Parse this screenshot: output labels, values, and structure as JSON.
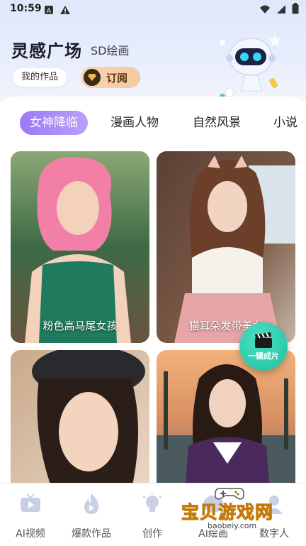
{
  "status_bar": {
    "time": "10:59",
    "icons_left": [
      "notification-a-icon",
      "warning-icon"
    ],
    "icons_right": [
      "wifi-icon",
      "signal-icon",
      "battery-icon"
    ]
  },
  "header": {
    "title": "灵感广场",
    "subtitle": "SD绘画",
    "my_works": "我的作品",
    "subscribe": "订阅"
  },
  "tabs": [
    {
      "label": "女神降临",
      "active": true
    },
    {
      "label": "漫画人物",
      "active": false
    },
    {
      "label": "自然风景",
      "active": false
    },
    {
      "label": "小说",
      "active": false
    }
  ],
  "cards": [
    {
      "caption": "粉色高马尾女孩"
    },
    {
      "caption": "猫耳朵发带美女"
    },
    {
      "caption": ""
    },
    {
      "caption": ""
    }
  ],
  "fab": {
    "label": "一键成片",
    "icon": "clapperboard-icon"
  },
  "bottom_nav": [
    {
      "label": "AI视频",
      "icon": "tv-icon"
    },
    {
      "label": "爆款作品",
      "icon": "flame-play-icon"
    },
    {
      "label": "创作",
      "icon": "lightbulb-icon"
    },
    {
      "label": "AI绘画",
      "icon": "palette-icon"
    },
    {
      "label": "数字人",
      "icon": "person-icon"
    }
  ],
  "watermark": {
    "text": "宝贝游戏网",
    "url": "baobeiy.com"
  },
  "colors": {
    "accent": "#a586f6",
    "fab": "#2ccfb1",
    "subscribe": "#f5cfa8"
  }
}
